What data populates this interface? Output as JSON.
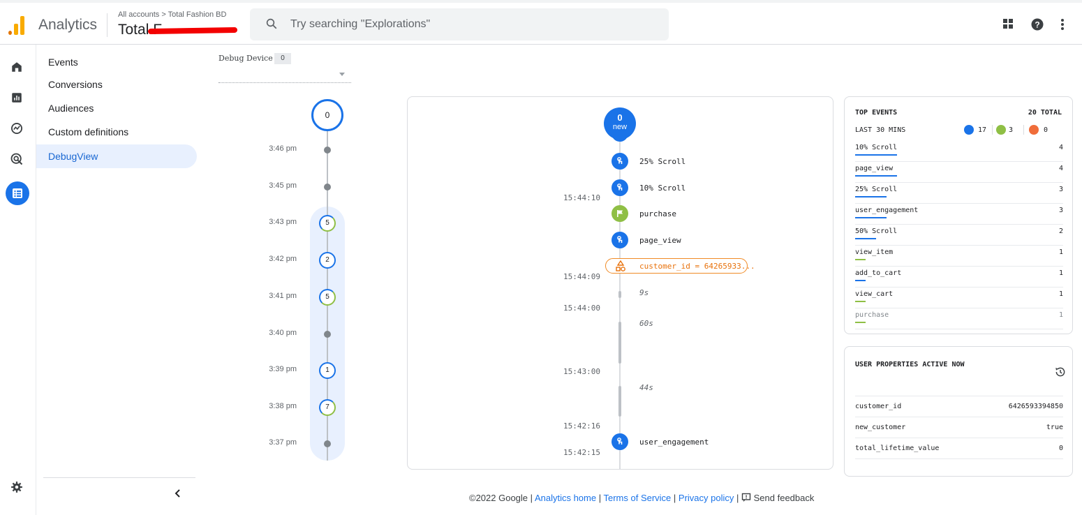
{
  "header": {
    "app_name": "Analytics",
    "breadcrumb": "All accounts > Total Fashion BD",
    "property_name": "Total F",
    "search_placeholder": "Try searching \"Explorations\"",
    "brand_colors": {
      "logo_orange": "#f9ab00",
      "logo_dark": "#e37400",
      "accent": "#1a73e8"
    }
  },
  "rail": {
    "icons": [
      "home-icon",
      "reports-icon",
      "explore-icon",
      "advertising-icon",
      "configure-icon",
      "admin-gear-icon"
    ]
  },
  "subnav": {
    "items": [
      {
        "label": "Events"
      },
      {
        "label": "Conversions"
      },
      {
        "label": "Audiences"
      },
      {
        "label": "Custom definitions"
      },
      {
        "label": "DebugView",
        "active": true
      }
    ]
  },
  "debug_device": {
    "label": "Debug Device",
    "count": "0"
  },
  "minutes_stream": {
    "top_count": "0",
    "rows": [
      {
        "time": "3:46 pm",
        "count": null
      },
      {
        "time": "3:45 pm",
        "count": null
      },
      {
        "time": "3:43 pm",
        "count": "5"
      },
      {
        "time": "3:42 pm",
        "count": "2"
      },
      {
        "time": "3:41 pm",
        "count": "5"
      },
      {
        "time": "3:40 pm",
        "count": null
      },
      {
        "time": "3:39 pm",
        "count": "1"
      },
      {
        "time": "3:38 pm",
        "count": "7"
      },
      {
        "time": "3:37 pm",
        "count": null
      }
    ]
  },
  "seconds_stream": {
    "new_count": "0",
    "new_label": "new",
    "events": [
      {
        "name": "25% Scroll",
        "type": "blue"
      },
      {
        "name": "10% Scroll",
        "type": "blue"
      },
      {
        "name": "purchase",
        "type": "green"
      },
      {
        "name": "page_view",
        "type": "blue"
      },
      {
        "name": "user_engagement",
        "type": "blue"
      }
    ],
    "property_chip": "customer_id = 64265933...",
    "timestamps": [
      "15:44:10",
      "15:44:09",
      "15:44:00",
      "15:43:00",
      "15:42:16",
      "15:42:15"
    ],
    "gaps": [
      "9s",
      "60s",
      "44s"
    ]
  },
  "top_events": {
    "title": "TOP EVENTS",
    "total": "20 TOTAL",
    "period": "LAST 30 MINS",
    "counts": {
      "events": "17",
      "conversions": "3",
      "errors": "0"
    },
    "colors": {
      "event": "#1a73e8",
      "conversion": "#8fbf45",
      "error": "#f06d3a"
    },
    "rows": [
      {
        "name": "10% Scroll",
        "count": "4",
        "value": 4,
        "kind": "event"
      },
      {
        "name": "page_view",
        "count": "4",
        "value": 4,
        "kind": "event"
      },
      {
        "name": "25% Scroll",
        "count": "3",
        "value": 3,
        "kind": "event"
      },
      {
        "name": "user_engagement",
        "count": "3",
        "value": 3,
        "kind": "event"
      },
      {
        "name": "50% Scroll",
        "count": "2",
        "value": 2,
        "kind": "event"
      },
      {
        "name": "view_item",
        "count": "1",
        "value": 1,
        "kind": "conversion"
      },
      {
        "name": "add_to_cart",
        "count": "1",
        "value": 1,
        "kind": "event"
      },
      {
        "name": "view_cart",
        "count": "1",
        "value": 1,
        "kind": "conversion"
      },
      {
        "name": "purchase",
        "count": "1",
        "value": 1,
        "kind": "conversion"
      }
    ]
  },
  "user_properties": {
    "title": "USER PROPERTIES ACTIVE NOW",
    "rows": [
      {
        "name": "customer_id",
        "value": "6426593394850"
      },
      {
        "name": "new_customer",
        "value": "true"
      },
      {
        "name": "total_lifetime_value",
        "value": "0"
      }
    ]
  },
  "footer": {
    "copyright": "©2022 Google",
    "analytics_home": "Analytics home",
    "terms": "Terms of Service",
    "privacy": "Privacy policy",
    "feedback": "Send feedback"
  }
}
